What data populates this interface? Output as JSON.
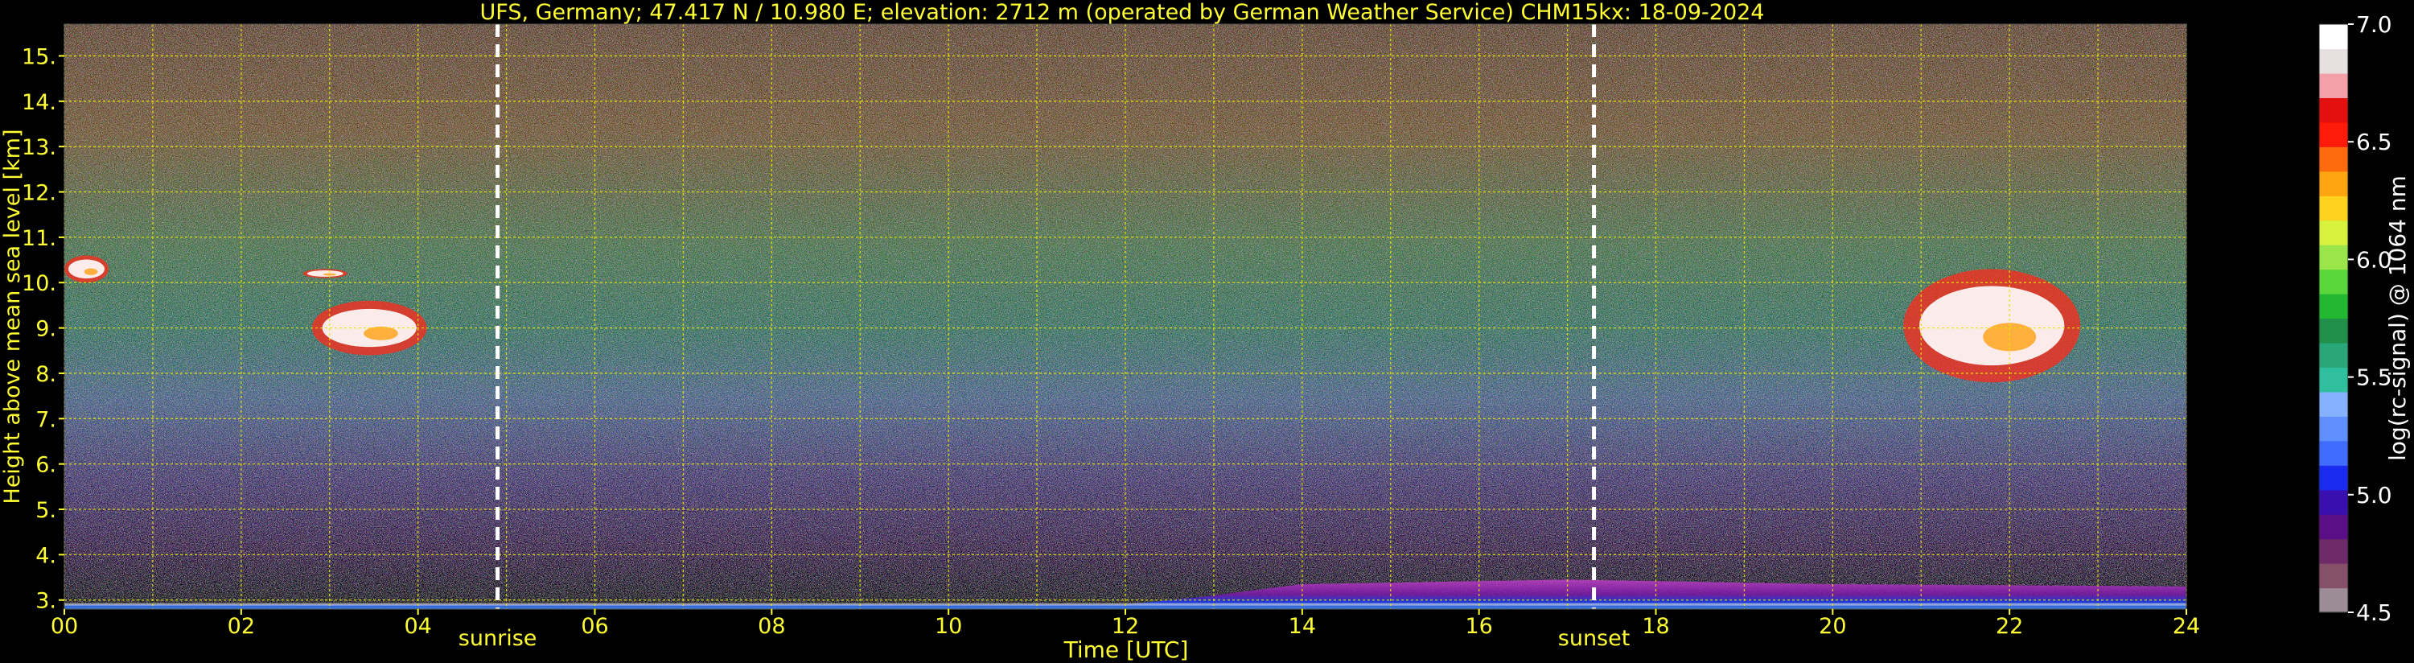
{
  "chart_data": {
    "type": "heatmap",
    "title": "UFS, Germany; 47.417 N / 10.980 E; elevation: 2712 m  (operated by German Weather Service)    CHM15kx: 18-09-2024",
    "xlabel": "Time [UTC]",
    "ylabel": "Height above mean sea level [km]",
    "xlim": [
      0,
      24
    ],
    "ylim": [
      2.8,
      15.7
    ],
    "x_ticks": [
      "00",
      "02",
      "04",
      "06",
      "08",
      "10",
      "12",
      "14",
      "16",
      "18",
      "20",
      "22",
      "24"
    ],
    "y_ticks": [
      "3.",
      "4.",
      "5.",
      "6.",
      "7.",
      "8.",
      "9.",
      "10.",
      "11.",
      "12.",
      "13.",
      "14.",
      "15."
    ],
    "grid": true,
    "events": [
      {
        "label": "sunrise",
        "time": 4.9
      },
      {
        "label": "sunset",
        "time": 17.3
      }
    ],
    "clouds": [
      {
        "t_start": 0.0,
        "t_end": 0.5,
        "h_low": 10.0,
        "h_high": 10.6
      },
      {
        "t_start": 2.7,
        "t_end": 3.2,
        "h_low": 10.1,
        "h_high": 10.3
      },
      {
        "t_start": 2.8,
        "t_end": 4.1,
        "h_low": 8.4,
        "h_high": 9.6
      },
      {
        "t_start": 20.8,
        "t_end": 22.8,
        "h_low": 7.8,
        "h_high": 10.3
      }
    ],
    "boundary_layer": [
      {
        "t": 0,
        "h": 2.9
      },
      {
        "t": 12,
        "h": 2.9
      },
      {
        "t": 13,
        "h": 3.1
      },
      {
        "t": 14,
        "h": 3.35
      },
      {
        "t": 17,
        "h": 3.45
      },
      {
        "t": 20,
        "h": 3.35
      },
      {
        "t": 24,
        "h": 3.3
      }
    ],
    "colorbar": {
      "label": "log(rc-signal) @ 1064 nm",
      "min": 4.5,
      "max": 7.0,
      "ticks": [
        "4.5",
        "5.0",
        "5.5",
        "6.0",
        "6.5",
        "7.0"
      ],
      "colors": [
        "#9c8c95",
        "#86506a",
        "#6e2b68",
        "#5b0f86",
        "#3a0fb0",
        "#1a2bf0",
        "#3f6bff",
        "#5f8eff",
        "#86b1ff",
        "#2fbf9f",
        "#2aa77a",
        "#1f8f4a",
        "#23b832",
        "#58d63a",
        "#9ae64a",
        "#d7f13c",
        "#ffd21f",
        "#ffa510",
        "#ff6a0c",
        "#ff1a0a",
        "#e40f0f",
        "#f4a0a8",
        "#e6e0e0",
        "#ffffff"
      ]
    },
    "colors": {
      "background": "#000000",
      "annotation": "#ffff33",
      "grid": "#e6e600",
      "event_line": "#ffffff"
    }
  }
}
